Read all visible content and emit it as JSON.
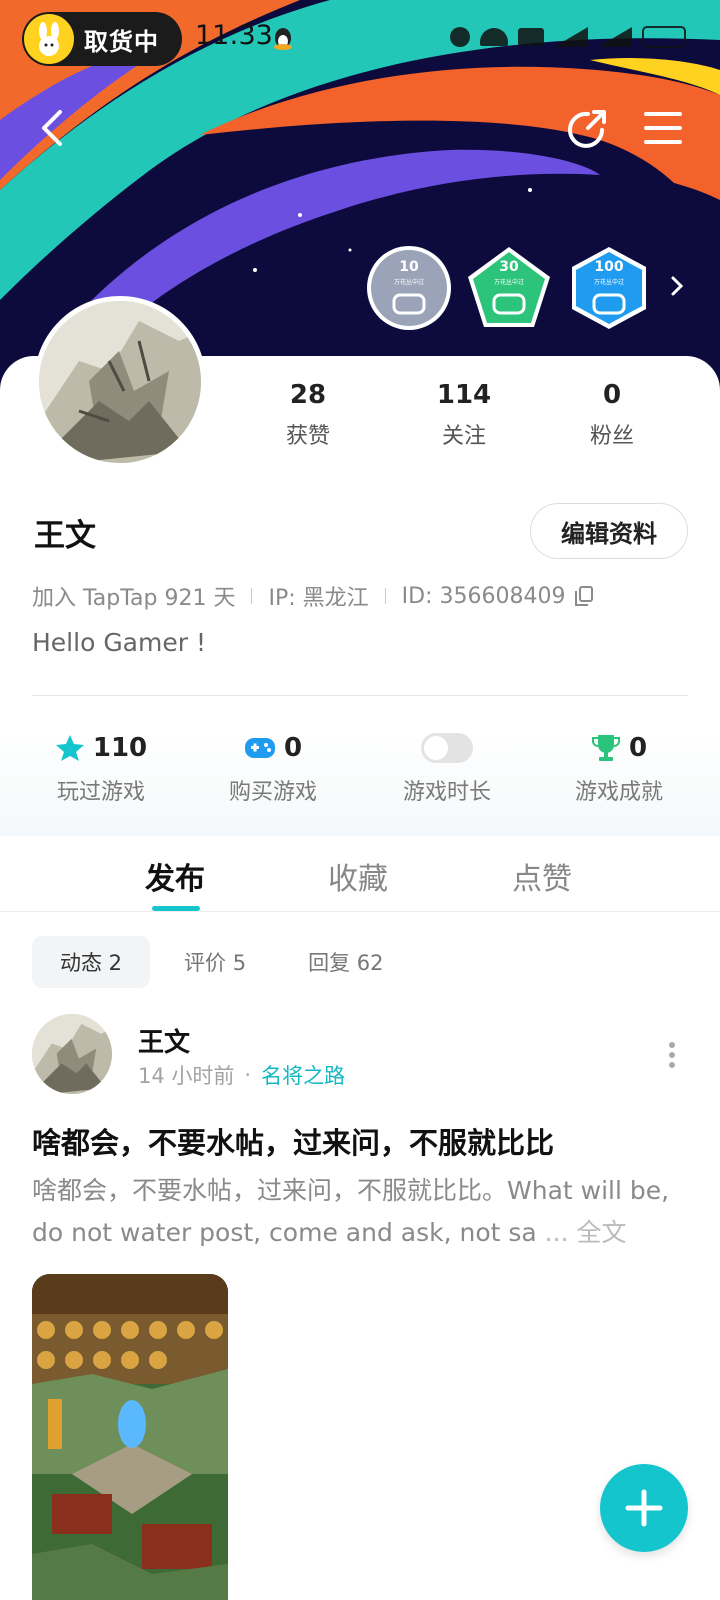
{
  "status_bar": {
    "pill_label": "取货中",
    "time": "11:33"
  },
  "header": {
    "badges": [
      {
        "num": "10",
        "sub": "万花丛中过",
        "color": "#9aa3b8"
      },
      {
        "num": "30",
        "sub": "万花丛中过",
        "color": "#2cc37b"
      },
      {
        "num": "100",
        "sub": "万花丛中过",
        "color": "#1f9cf0"
      }
    ]
  },
  "profile": {
    "stats": [
      {
        "value": "28",
        "label": "获赞"
      },
      {
        "value": "114",
        "label": "关注"
      },
      {
        "value": "0",
        "label": "粉丝"
      }
    ],
    "name": "王文",
    "edit_label": "编辑资料",
    "joined": "加入 TapTap 921 天",
    "ip": "IP:  黑龙江",
    "id": "ID:  356608409",
    "bio": "Hello Gamer !"
  },
  "game_stats": [
    {
      "value": "110",
      "label": "玩过游戏",
      "icon": "star-icon",
      "color": "#15c5ce"
    },
    {
      "value": "0",
      "label": "购买游戏",
      "icon": "gamepad-icon",
      "color": "#1f9cf0"
    },
    {
      "value": "",
      "label": "游戏时长",
      "icon": "toggle-switch"
    },
    {
      "value": "0",
      "label": "游戏成就",
      "icon": "trophy-icon",
      "color": "#2cc37b"
    }
  ],
  "tabs": [
    "发布",
    "收藏",
    "点赞"
  ],
  "subtabs": [
    "动态 2",
    "评价 5",
    "回复 62"
  ],
  "post": {
    "author": "王文",
    "time": "14 小时前",
    "game": "名将之路",
    "title": "啥都会，不要水帖，过来问，不服就比比",
    "body": "啥都会，不要水帖，过来问，不服就比比。What will be, do not water post, come and ask, not sa",
    "more": "... 全文"
  },
  "colors": {
    "accent": "#15c5ce"
  }
}
